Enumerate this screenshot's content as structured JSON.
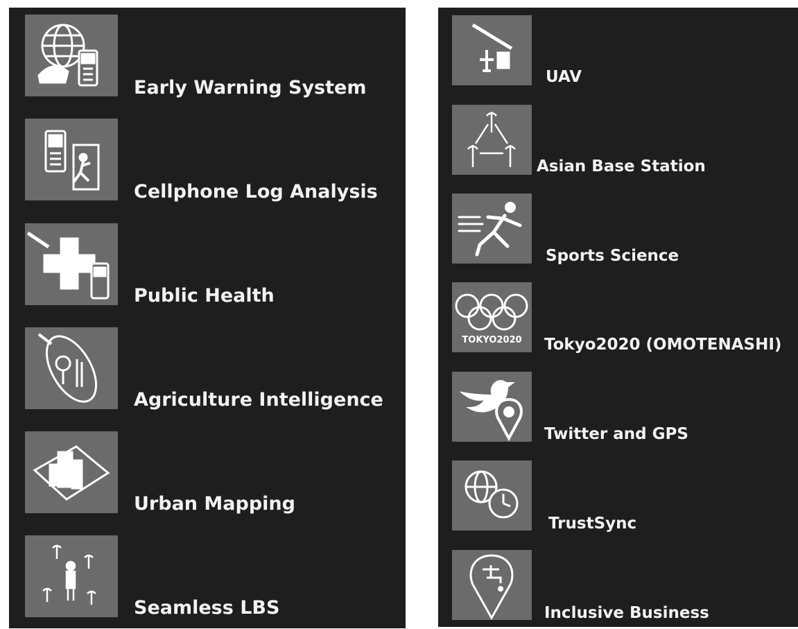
{
  "left_panel": {
    "items": [
      {
        "label": "Early Warning System",
        "icon": "globe-helmet-phone-icon"
      },
      {
        "label": "Cellphone Log Analysis",
        "icon": "phone-exit-door-icon"
      },
      {
        "label": "Public Health",
        "icon": "medical-cross-icon"
      },
      {
        "label": "Agriculture Intelligence",
        "icon": "agriculture-orbit-icon"
      },
      {
        "label": "Urban Mapping",
        "icon": "city-buildings-icon"
      },
      {
        "label": "Seamless LBS",
        "icon": "person-antennas-icon"
      }
    ]
  },
  "right_panel": {
    "items": [
      {
        "label": "UAV",
        "icon": "satellite-drone-icon"
      },
      {
        "label": "Asian Base Station",
        "icon": "antenna-triangle-icon"
      },
      {
        "label": "Sports Science",
        "icon": "runner-icon"
      },
      {
        "label": "Tokyo2020 (OMOTENASHI)",
        "icon": "olympic-rings-icon",
        "icon_text": "TOKYO2020"
      },
      {
        "label": "Twitter and GPS",
        "icon": "bird-location-pin-icon"
      },
      {
        "label": "TrustSync",
        "icon": "globe-clock-icon"
      },
      {
        "label": "Inclusive Business",
        "icon": "water-tap-pin-icon"
      }
    ]
  },
  "colors": {
    "panel_bg": "#1e1e1e",
    "tile_bg": "#6b6b6b",
    "label_text": "#f2f2f2",
    "icon_stroke": "#ffffff"
  }
}
